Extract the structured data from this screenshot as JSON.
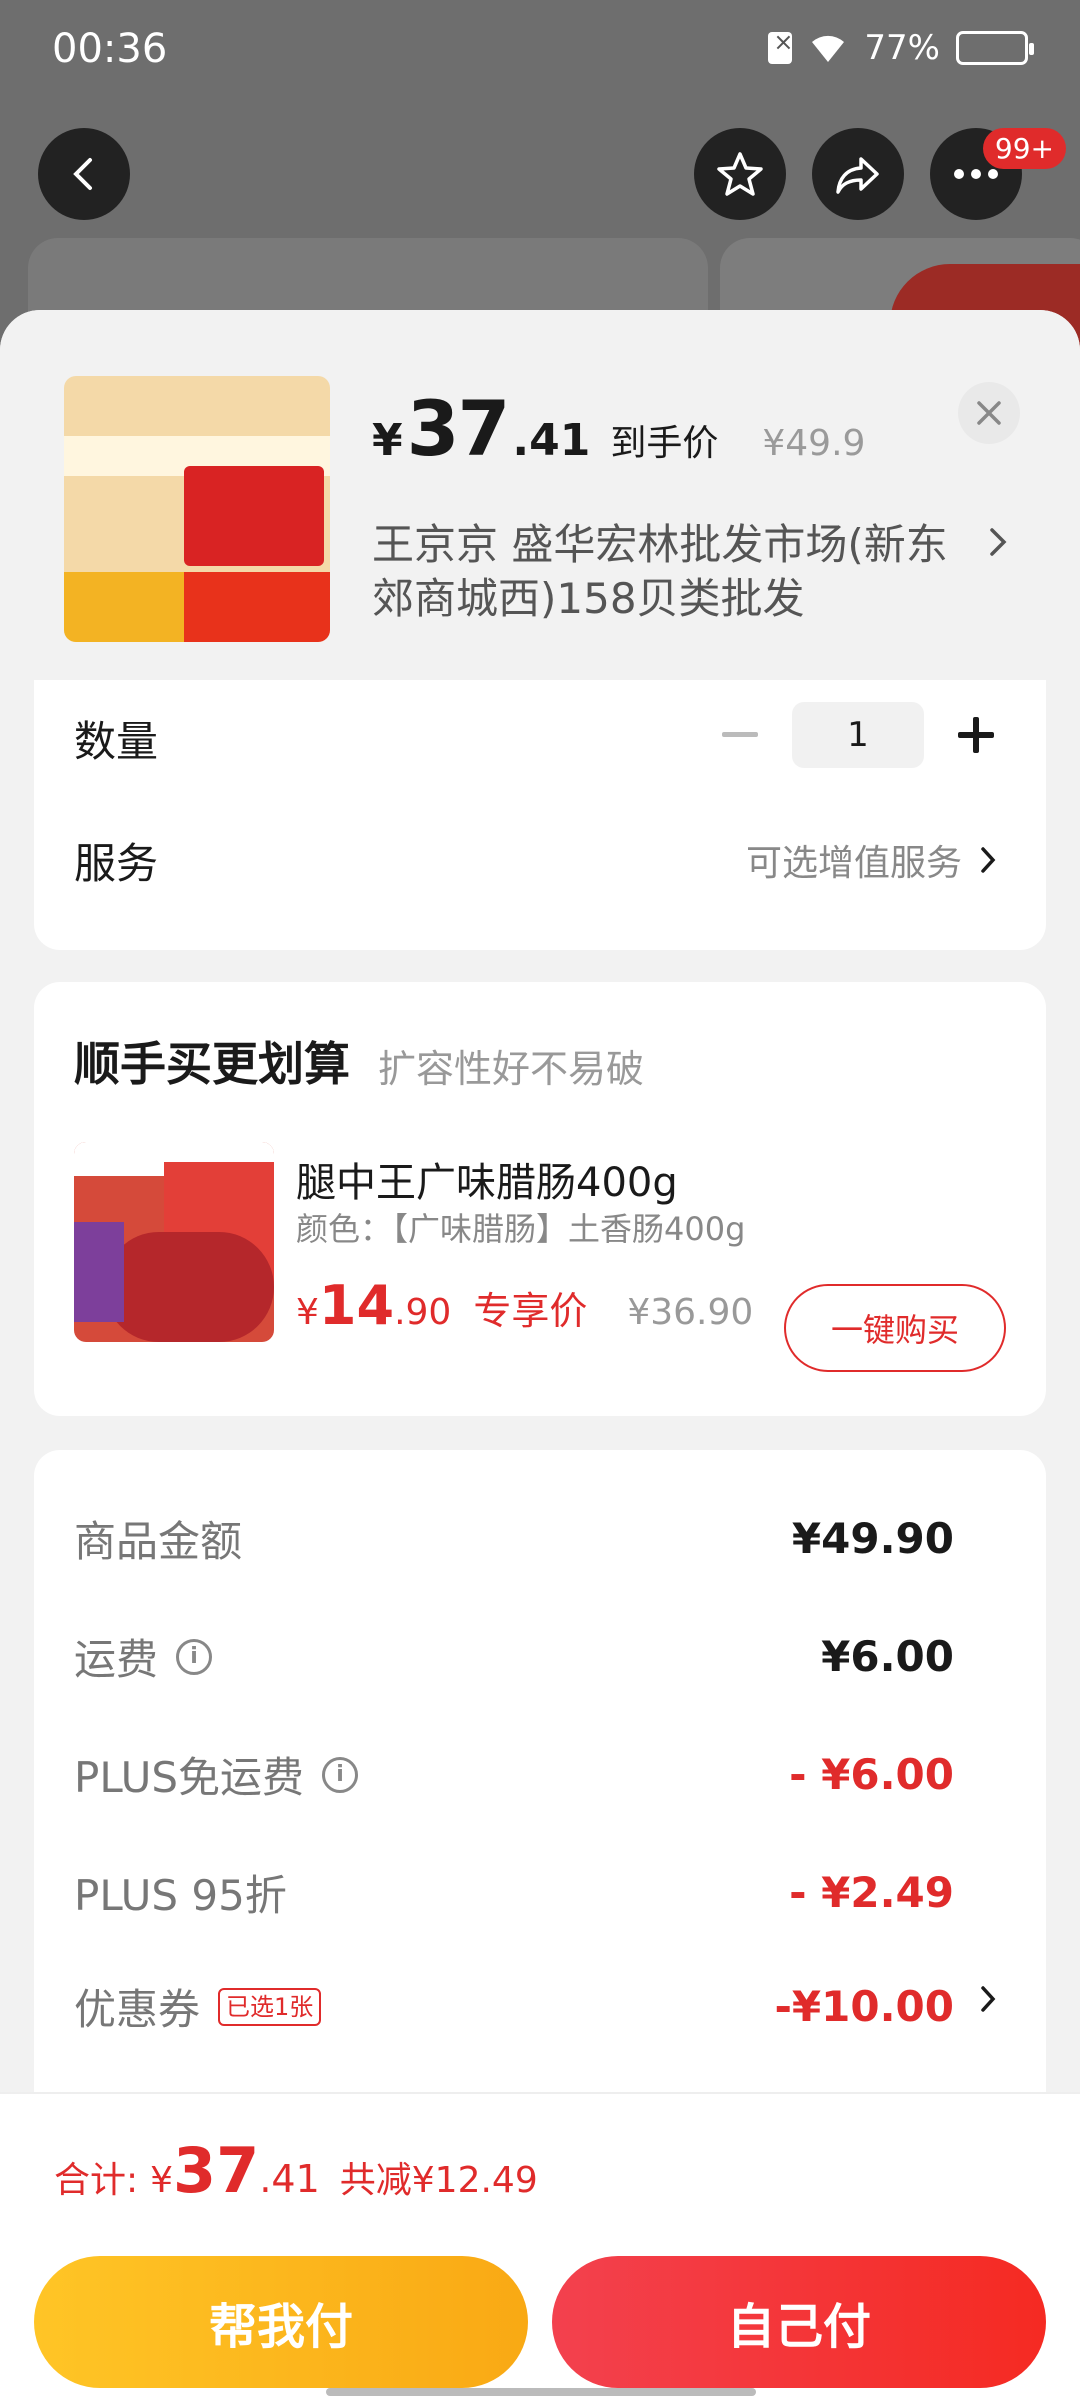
{
  "status_bar": {
    "time": "00:36",
    "battery": "77%"
  },
  "top_nav": {
    "badge": "99+"
  },
  "product": {
    "price_symbol": "¥",
    "price_int": "37",
    "price_dec": ".41",
    "price_label": "到手价",
    "original_price": "¥49.9",
    "store": "王京京  盛华宏林批发市场(新东郊商城西)158贝类批发"
  },
  "quantity": {
    "label": "数量",
    "value": "1"
  },
  "service": {
    "label": "服务",
    "value": "可选增值服务"
  },
  "bundle": {
    "title": "顺手买更划算",
    "subtitle": "扩容性好不易破",
    "item": {
      "name": "腿中王广味腊肠400g",
      "spec": "颜色：【广味腊肠】土香肠400g",
      "price_symbol": "¥",
      "price_int": "14",
      "price_dec": ".90",
      "price_label": "专享价",
      "original_price": "¥36.90",
      "buy_label": "一键购买"
    }
  },
  "fees": [
    {
      "label": "商品金额",
      "value": "¥49.90",
      "info": false,
      "red": false
    },
    {
      "label": "运费",
      "value": "¥6.00",
      "info": true,
      "red": false
    },
    {
      "label": "PLUS免运费",
      "value": "- ¥6.00",
      "info": true,
      "red": true
    },
    {
      "label": "PLUS 95折",
      "value": "- ¥2.49",
      "info": false,
      "red": true
    },
    {
      "label": "优惠券",
      "value": "-¥10.00",
      "chip": "已选1张",
      "info": false,
      "red": true
    }
  ],
  "footer": {
    "total_label": "合计:",
    "total_symbol": "¥",
    "total_int": "37",
    "total_dec": ".41",
    "saved": "共减¥12.49",
    "help_pay": "帮我付",
    "self_pay": "自己付"
  },
  "colors": {
    "accent_red": "#e02b2b",
    "yellow": "#ffc526"
  }
}
